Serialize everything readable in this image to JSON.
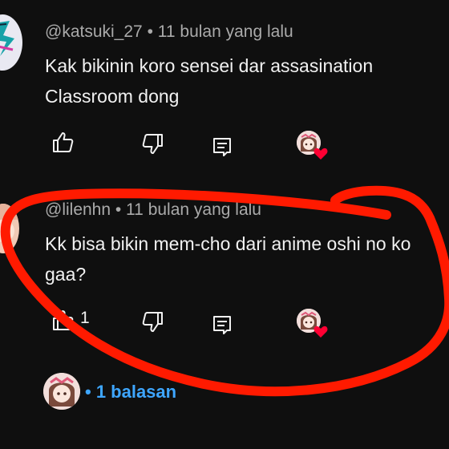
{
  "comments": [
    {
      "handle": "@katsuki_27",
      "time": "• 11 bulan yang lalu",
      "text": "Kak bikinin koro sensei dar assasination\nClassroom dong",
      "like_count": ""
    },
    {
      "handle": "@lilenhn",
      "time": "• 11 bulan yang lalu",
      "text": "Kk bisa bikin mem-cho dari anime oshi no ko\ngaa?",
      "like_count": "1"
    }
  ],
  "replies_label": "• 1 balasan",
  "icons": {
    "like": "thumbs-up-icon",
    "dislike": "thumbs-down-icon",
    "reply": "reply-comment-icon",
    "creator_heart": "creator-heart-icon"
  },
  "colors": {
    "background": "#0f0f0f",
    "text": "#f1f1f1",
    "meta": "#aaaaaa",
    "link": "#3ea6ff",
    "heart": "#ff0033",
    "marker": "#ff1a00"
  }
}
